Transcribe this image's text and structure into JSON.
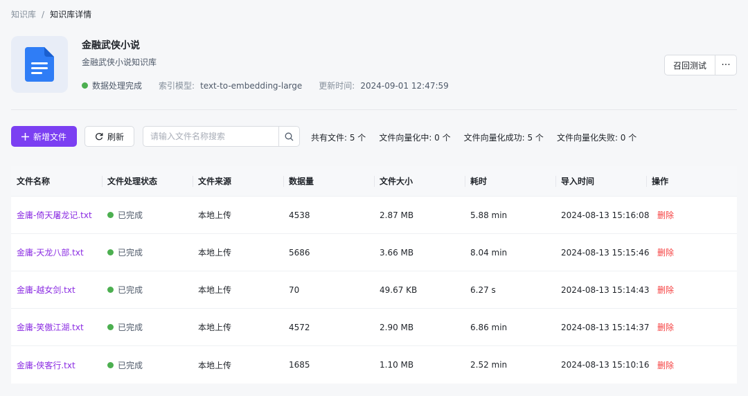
{
  "breadcrumb": {
    "parent": "知识库",
    "separator": "/",
    "current": "知识库详情"
  },
  "kb": {
    "title": "金融武侠小说",
    "description": "金融武侠小说知识库",
    "status": "数据处理完成",
    "model_label": "索引模型:",
    "model_value": "text-to-embedding-large",
    "updated_label": "更新时间:",
    "updated_value": "2024-09-01 12:47:59"
  },
  "header_actions": {
    "recall_label": "召回测试",
    "more_label": "···"
  },
  "toolbar": {
    "add_label": "新增文件",
    "refresh_label": "刷新",
    "search_placeholder": "请输入文件名称搜索",
    "stats": {
      "total": "共有文件: 5 个",
      "processing": "文件向量化中: 0 个",
      "success": "文件向量化成功: 5 个",
      "failed": "文件向量化失败: 0 个"
    }
  },
  "table": {
    "headers": [
      "文件名称",
      "文件处理状态",
      "文件来源",
      "数据量",
      "文件大小",
      "耗时",
      "导入时间",
      "操作"
    ],
    "rows": [
      {
        "name": "金庸-倚天屠龙记.txt",
        "status": "已完成",
        "source": "本地上传",
        "count": "4538",
        "size": "2.87 MB",
        "duration": "5.88 min",
        "time": "2024-08-13 15:16:08",
        "action": "删除"
      },
      {
        "name": "金庸-天龙八部.txt",
        "status": "已完成",
        "source": "本地上传",
        "count": "5686",
        "size": "3.66 MB",
        "duration": "8.04 min",
        "time": "2024-08-13 15:15:46",
        "action": "删除"
      },
      {
        "name": "金庸-越女剑.txt",
        "status": "已完成",
        "source": "本地上传",
        "count": "70",
        "size": "49.67 KB",
        "duration": "6.27 s",
        "time": "2024-08-13 15:14:43",
        "action": "删除"
      },
      {
        "name": "金庸-笑傲江湖.txt",
        "status": "已完成",
        "source": "本地上传",
        "count": "4572",
        "size": "2.90 MB",
        "duration": "6.86 min",
        "time": "2024-08-13 15:14:37",
        "action": "删除"
      },
      {
        "name": "金庸-侠客行.txt",
        "status": "已完成",
        "source": "本地上传",
        "count": "1685",
        "size": "1.10 MB",
        "duration": "2.52 min",
        "time": "2024-08-13 15:10:16",
        "action": "删除"
      }
    ]
  },
  "colors": {
    "accent": "#7b3ff2",
    "link": "#8a2be2",
    "success": "#4caf50",
    "danger": "#f53f3f"
  },
  "icons": {
    "doc": "document-icon",
    "plus": "plus-icon",
    "refresh": "refresh-icon",
    "search": "search-icon",
    "more": "more-icon"
  }
}
